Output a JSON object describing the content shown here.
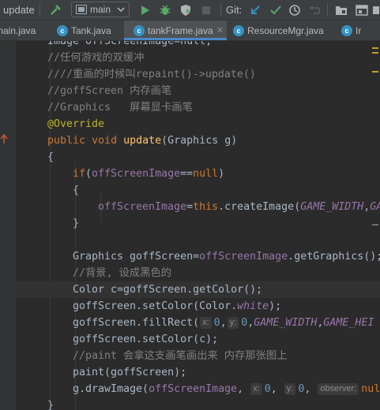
{
  "toolbar": {
    "run_config": "update",
    "branch": "main",
    "git_label": "Git:"
  },
  "tabs": [
    {
      "label": "main.java",
      "active": false
    },
    {
      "label": "Tank.java",
      "active": false
    },
    {
      "label": "tankFrame.java",
      "active": true
    },
    {
      "label": "ResourceMgr.java",
      "active": false
    },
    {
      "label": "Ir",
      "active": false
    }
  ],
  "code": {
    "l0": "Image offScreenImage=null;",
    "l1": "//任何游戏的双缓冲",
    "l2": "////重画的时候叫repaint()->update()",
    "l3": "//goffScreen 内存画笔",
    "l4": "//Graphics   屏幕显卡画笔",
    "l5": "@Override",
    "l6": {
      "kw1": "public",
      "kw2": "void",
      "name": "update",
      "rest": "(Graphics g)"
    },
    "l7": "{",
    "l8": {
      "kw": "if",
      "open": "(",
      "field": "offScreenImage",
      "op": "==",
      "lit": "null",
      "close": ")"
    },
    "l9": "{",
    "l10": {
      "field": "offScreenImage",
      "eq": "=",
      "kw": "this",
      "call": ".createImage(",
      "c1": "GAME_WIDTH",
      "comma": ",",
      "c2": "GA"
    },
    "l11": "}",
    "l13": {
      "pre": "Graphics goffScreen=",
      "field": "offScreenImage",
      "post": ".getGraphics();"
    },
    "l14": "//背景, 设成黑色的",
    "l15": "Color c=goffScreen.getColor();",
    "l16": {
      "pre": "goffScreen.setColor(Color.",
      "field": "white",
      "post": ");"
    },
    "l17": {
      "pre": "goffScreen.fillRect(",
      "h1": "x:",
      "v1": "0",
      "sep": ",",
      "h2": "y:",
      "v2": "0",
      "c1": "GAME_WIDTH",
      "c2": "GAME_HEI"
    },
    "l18": "goffScreen.setColor(c);",
    "l19": "//paint 会拿这支画笔画出来 内存那张图上",
    "l20": "paint(goffScreen);",
    "l21": {
      "pre": "g.drawImage(",
      "field": "offScreenImage",
      "h1": "x:",
      "v1": "0",
      "h2": "y:",
      "v2": "0",
      "h3": "observer:",
      "lit": "nul"
    },
    "l22": "}"
  },
  "colors": {
    "keyword": "#cc7832",
    "field": "#9876aa",
    "method": "#ffc66d",
    "comment": "#808080",
    "number": "#6897bb",
    "annotation": "#bbb529",
    "text": "#a9b7c6"
  }
}
